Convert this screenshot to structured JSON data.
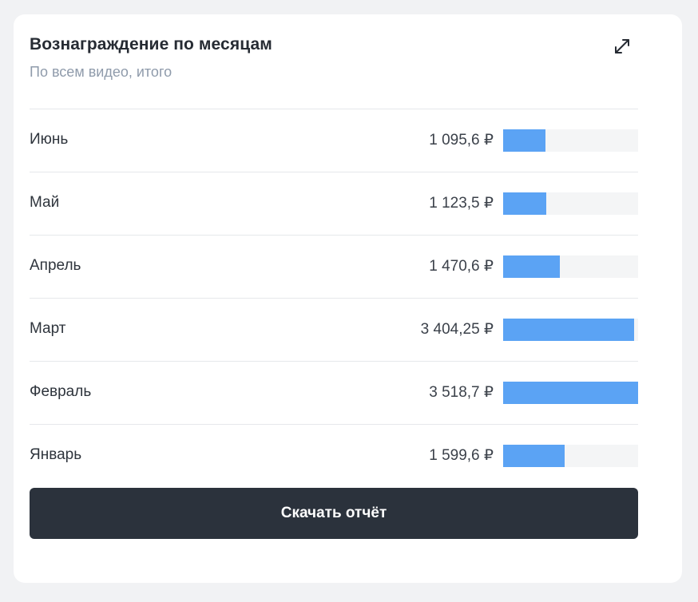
{
  "card": {
    "title": "Вознаграждение по месяцам",
    "subtitle": "По всем видео, итого",
    "expand_icon": "expand-arrow-icon"
  },
  "months": [
    {
      "label": "Июнь",
      "amount": "1 095,6 ₽",
      "value": 1095.6
    },
    {
      "label": "Май",
      "amount": "1 123,5 ₽",
      "value": 1123.5
    },
    {
      "label": "Апрель",
      "amount": "1 470,6 ₽",
      "value": 1470.6
    },
    {
      "label": "Март",
      "amount": "3 404,25 ₽",
      "value": 3404.25
    },
    {
      "label": "Февраль",
      "amount": "3 518,7 ₽",
      "value": 3518.7
    },
    {
      "label": "Январь",
      "amount": "1 599,6 ₽",
      "value": 1599.6
    }
  ],
  "bar_max": 3518.7,
  "download_button": {
    "label": "Скачать отчёт"
  },
  "colors": {
    "bar": "#5ba3f4",
    "bar_track": "#f4f5f6",
    "button_bg": "#2b323c",
    "page_bg": "#f1f2f4"
  }
}
